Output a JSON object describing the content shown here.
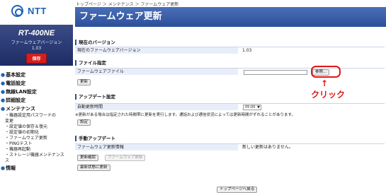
{
  "brand": {
    "logo_text": "NTT"
  },
  "device": {
    "model": "RT-400NE",
    "fw_label": "ファームウェアバージョン",
    "fw_version": "1.03",
    "save_label": "保存"
  },
  "menu": {
    "items": [
      {
        "label": "基本設定"
      },
      {
        "label": "電話設定"
      },
      {
        "label": "無線LAN設定"
      },
      {
        "label": "詳細設定"
      },
      {
        "label": "メンテナンス"
      }
    ],
    "maintenance_sub": [
      "・機器設定用パスワードの",
      "変更",
      "・設定値の保存＆復元",
      "・設定値の初期化",
      "・ファームウェア更新",
      "・PINGテスト",
      "・機器再起動",
      "・ストレージ機器メンテナンス",
      "ス"
    ],
    "info": {
      "label": "情報"
    }
  },
  "breadcrumb": "トップページ ＞ メンテナンス ＞ ファームウェア更新",
  "page_title": "ファームウェア更新",
  "current_version": {
    "heading": "現在のバージョン",
    "label": "現在のファームウェアバージョン",
    "value": "1.03"
  },
  "file_spec": {
    "heading": "ファイル指定",
    "label": "ファームウェアファイル",
    "browse_label": "参照...",
    "update_label": "更新"
  },
  "update_settings": {
    "heading": "アップデート設定",
    "label": "自動更新時間",
    "time_value": "05:00",
    "note": "※更新がある場合は指定された時間帯に更新を実行します。通話および通信状況によっては更新時間がずれることがあります。",
    "set_label": "設定"
  },
  "manual_update": {
    "heading": "手動アップデート",
    "label": "ファームウェア更新情報",
    "value": "新しい更新はありません。",
    "check_label": "更新確認",
    "fw_update_label": "ファームウェア更新",
    "latest_label": "最新状態に更新"
  },
  "footer": {
    "top_button_label": "トップページへ戻る"
  },
  "annotation": {
    "arrow": "↑",
    "text": "クリック",
    "color": "#e01818"
  },
  "colors": {
    "accent": "#2d4f9a",
    "brand": "#1f63b8",
    "save": "#d51e1e"
  }
}
